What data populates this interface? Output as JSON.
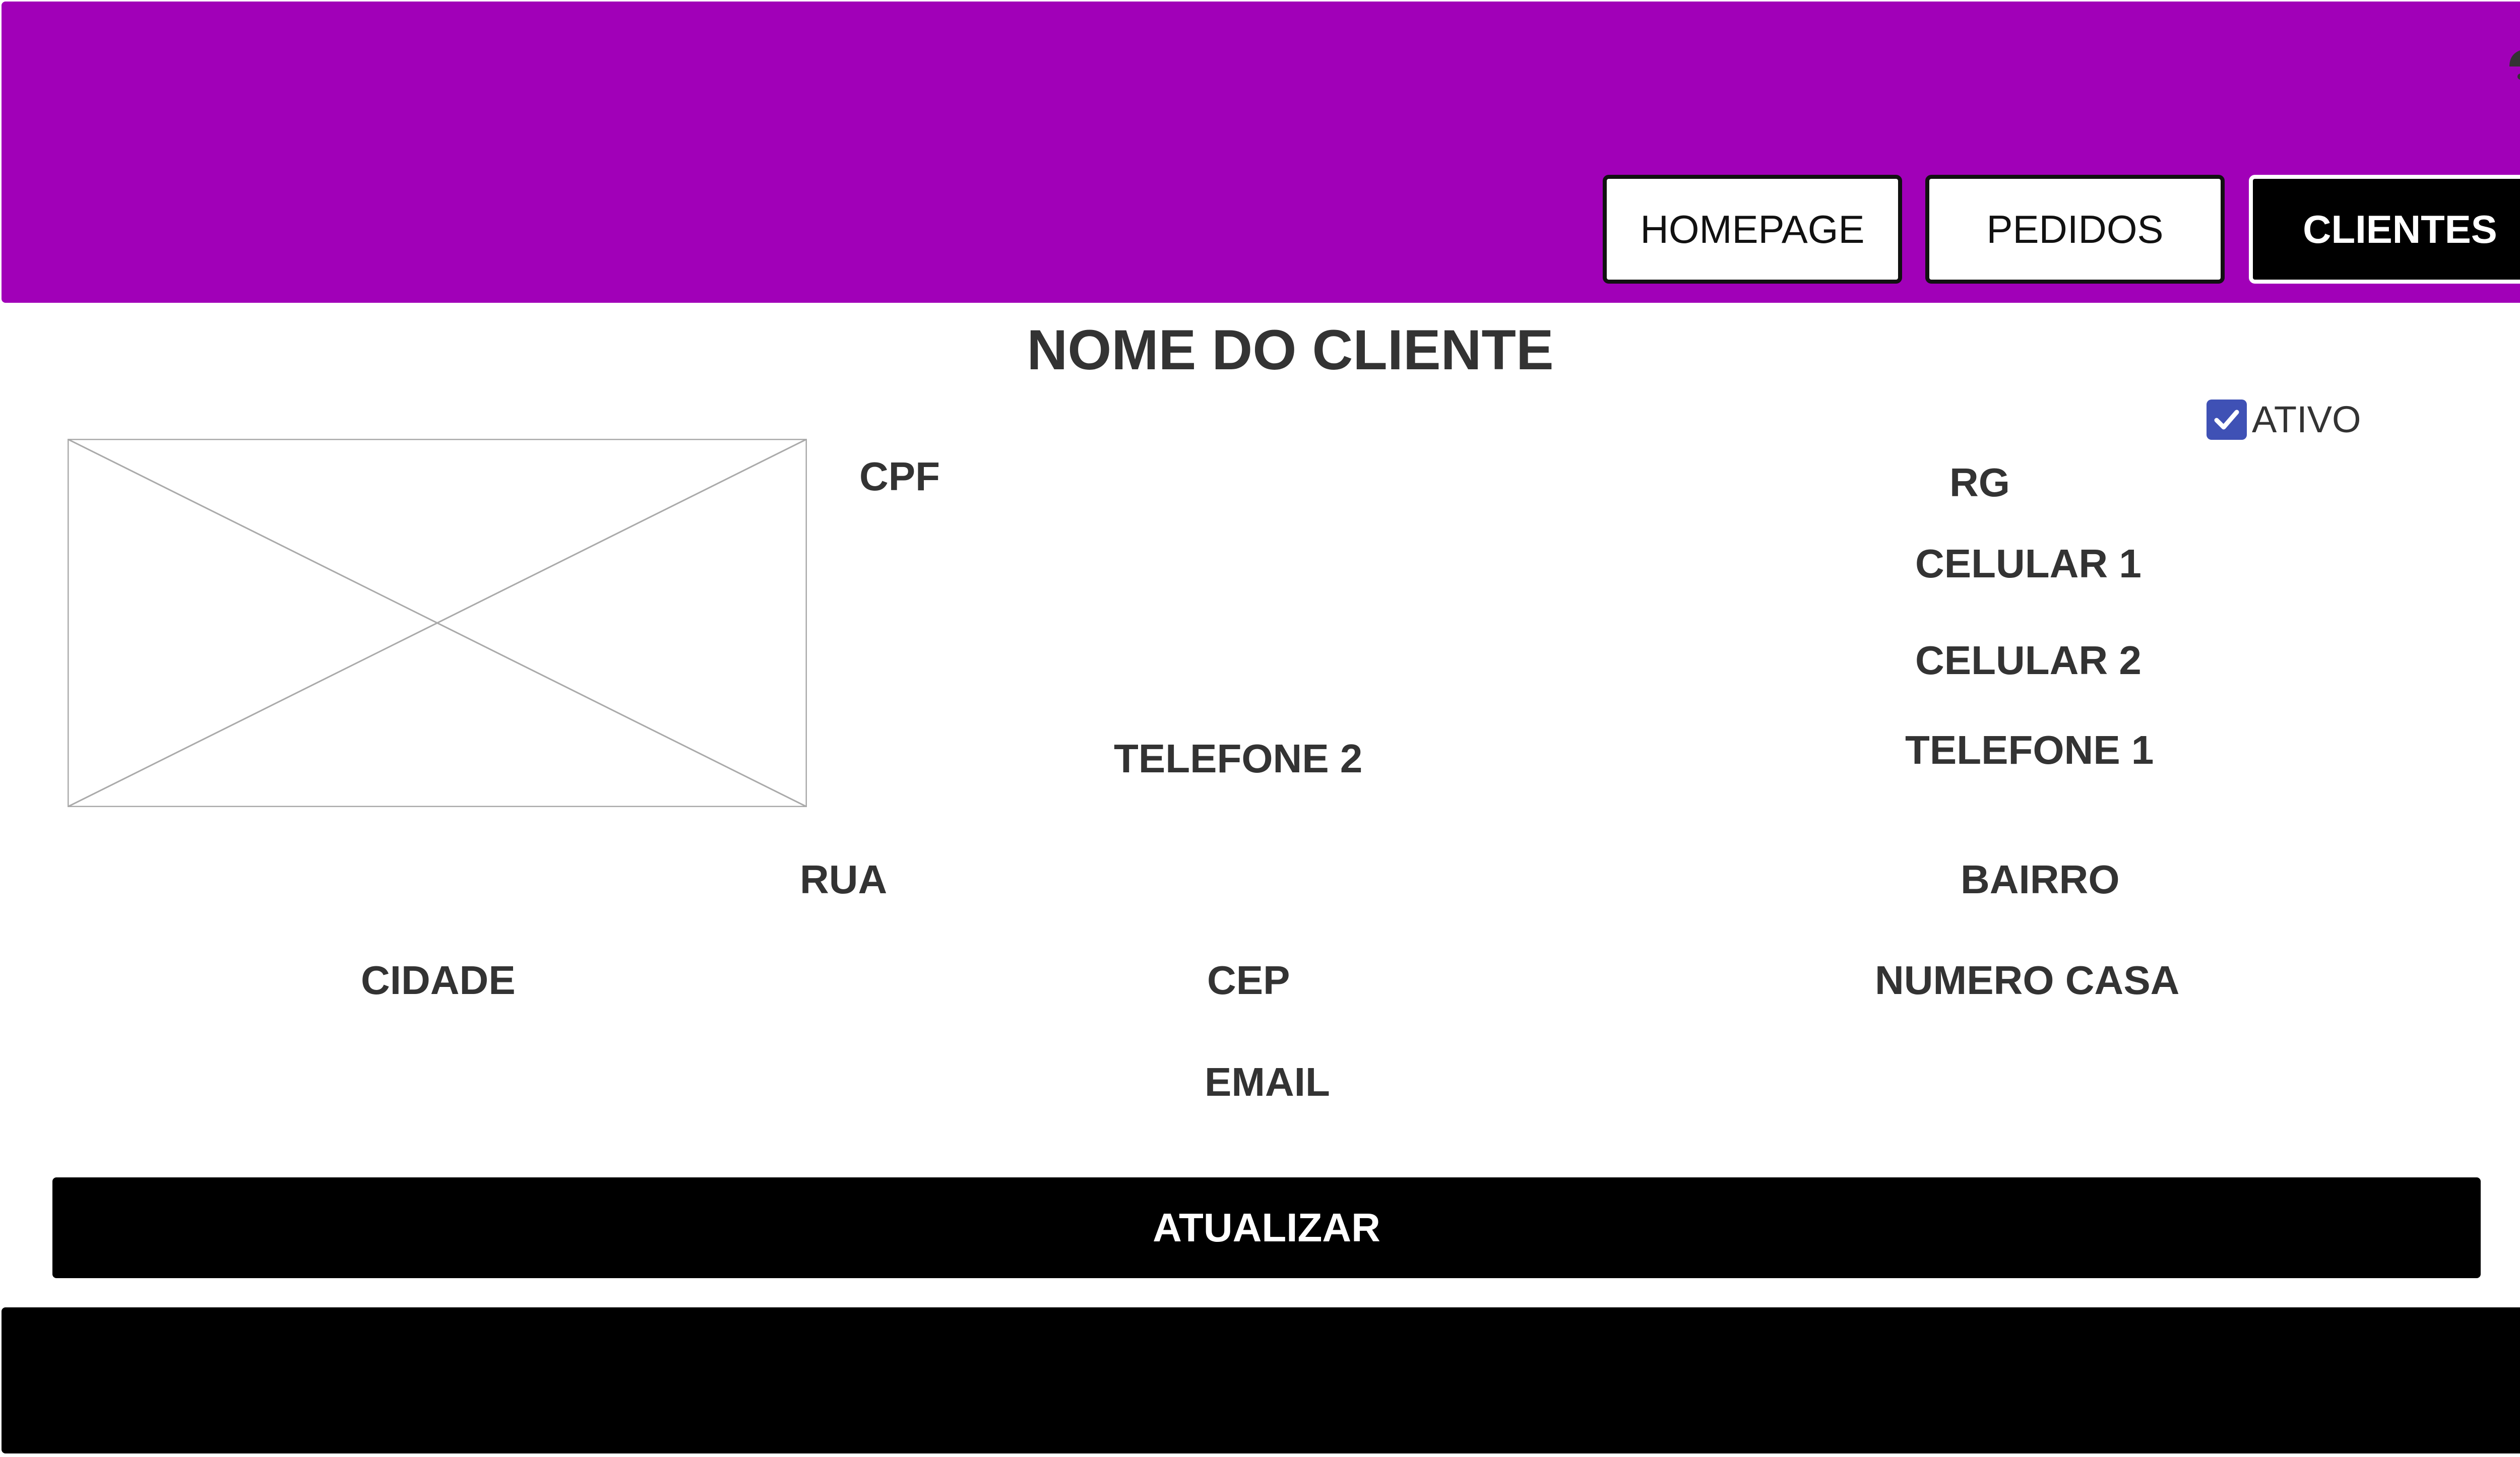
{
  "header": {
    "nav": {
      "home": "HOMEPAGE",
      "pedidos": "PEDIDOS",
      "clientes": "CLIENTES"
    },
    "user_icon": "user-icon"
  },
  "main": {
    "title": "NOME DO CLIENTE",
    "ativo_label": "ATIVO",
    "ativo_checked": true,
    "image_placeholder": "image-placeholder-icon",
    "fields": {
      "cpf": "CPF",
      "rg": "RG",
      "celular1": "CELULAR 1",
      "celular2": "CELULAR 2",
      "telefone1": "TELEFONE 1",
      "telefone2": "TELEFONE 2",
      "rua": "RUA",
      "bairro": "BAIRRO",
      "cidade": "CIDADE",
      "cep": "CEP",
      "numero_casa": "NUMERO CASA",
      "email": "EMAIL"
    },
    "update_button": "ATUALIZAR"
  },
  "colors": {
    "header": "#a100b8",
    "checkbox": "#3f51b5",
    "button": "#000000",
    "footer": "#000000"
  }
}
